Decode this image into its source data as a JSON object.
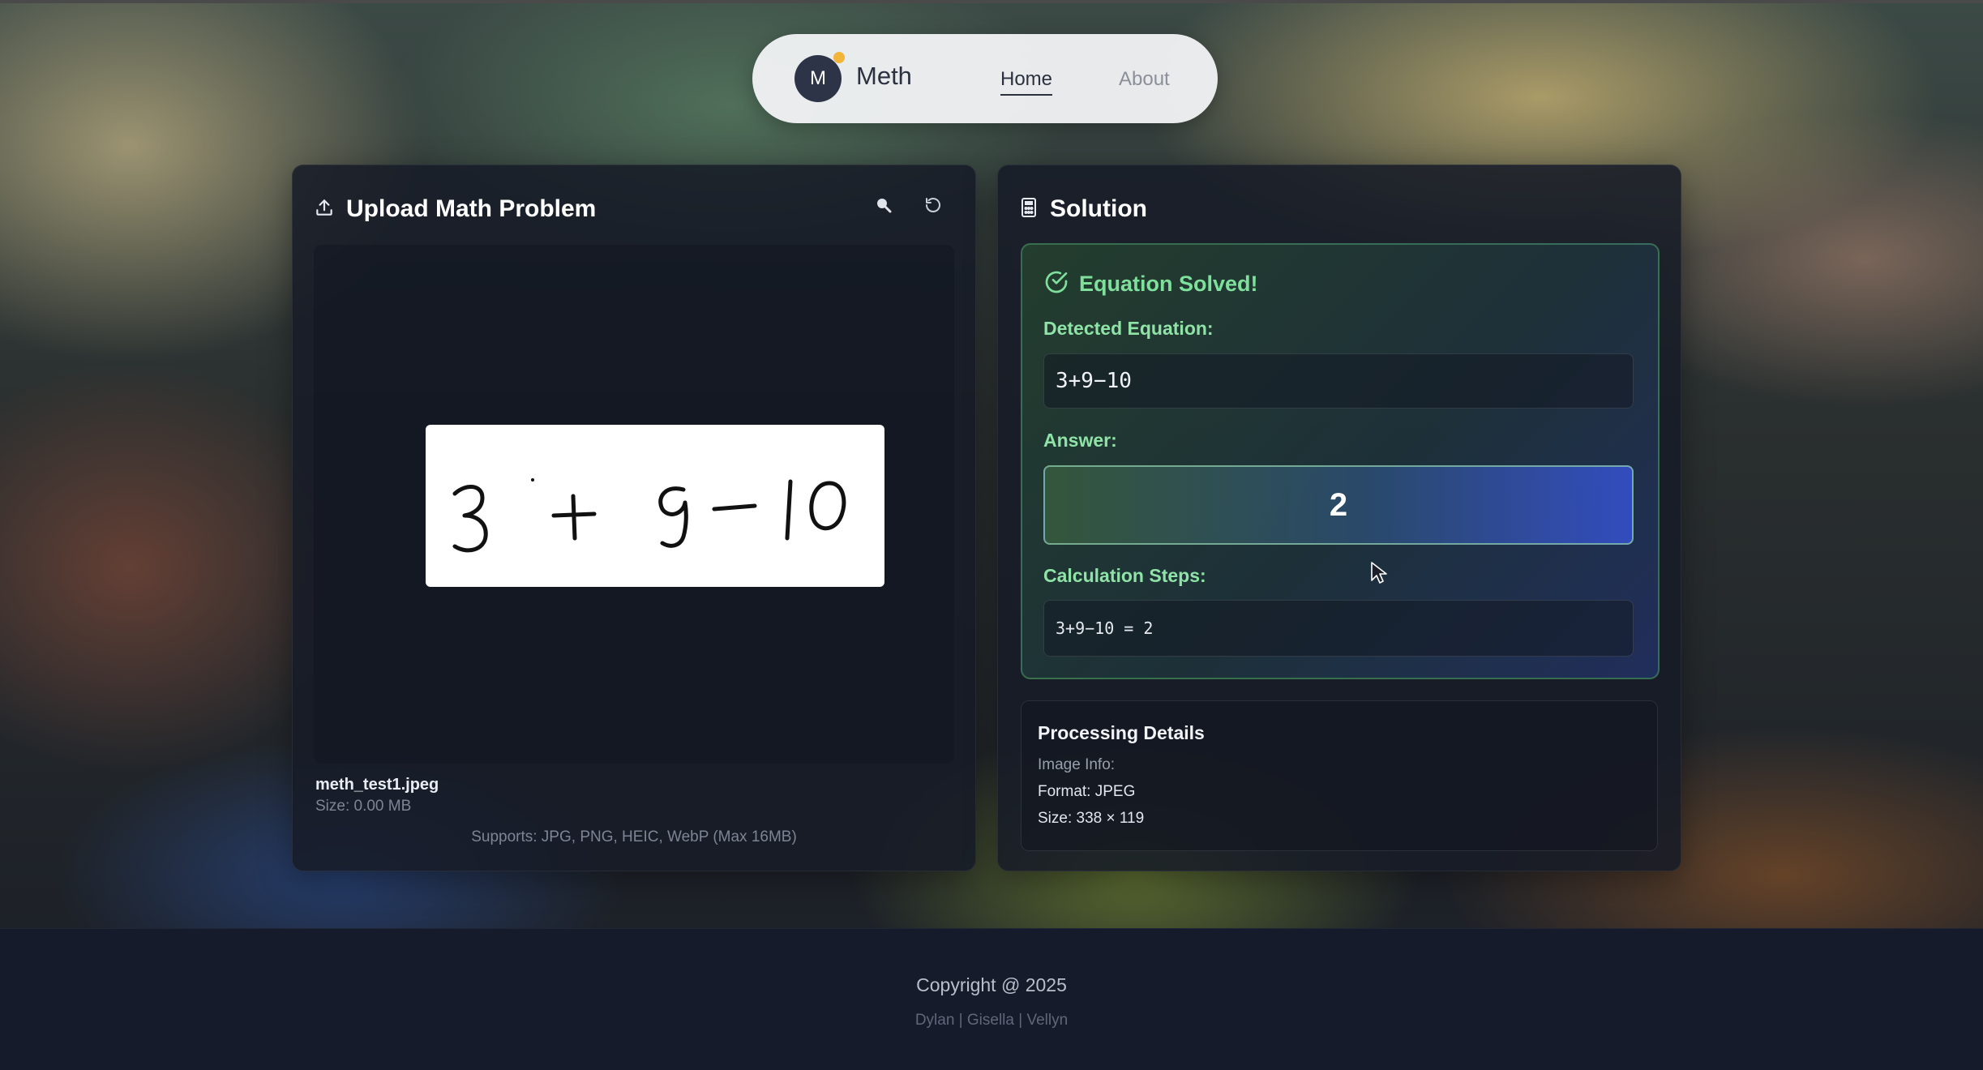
{
  "nav": {
    "avatar_letter": "M",
    "brand": "Meth",
    "links": [
      {
        "label": "Home",
        "active": true
      },
      {
        "label": "About",
        "active": false
      }
    ]
  },
  "upload": {
    "title": "Upload Math Problem",
    "image_text": "3 + 9 − 10",
    "file_name": "meth_test1.jpeg",
    "file_size": "Size: 0.00 MB",
    "supports": "Supports: JPG, PNG, HEIC, WebP (Max 16MB)"
  },
  "solution": {
    "title": "Solution",
    "status": "Equation Solved!",
    "detected_label": "Detected Equation:",
    "detected_value": "3+9−10",
    "answer_label": "Answer:",
    "answer_value": "2",
    "steps_label": "Calculation Steps:",
    "steps_value": "3+9−10 = 2"
  },
  "processing": {
    "title": "Processing Details",
    "image_info_label": "Image Info:",
    "format": "Format: JPEG",
    "size": "Size: 338 × 119"
  },
  "footer": {
    "copyright": "Copyright @ 2025",
    "credits": "Dylan | Gisella | Vellyn"
  },
  "colors": {
    "success_green": "#7fe09c",
    "answer_blue": "#344ec4",
    "nav_bg": "#f2f3f5",
    "card_bg": "#161b26"
  },
  "icons": [
    "upload-icon",
    "search-icon",
    "refresh-icon",
    "calculator-icon",
    "check-circle-icon",
    "pointer-cursor-icon"
  ]
}
